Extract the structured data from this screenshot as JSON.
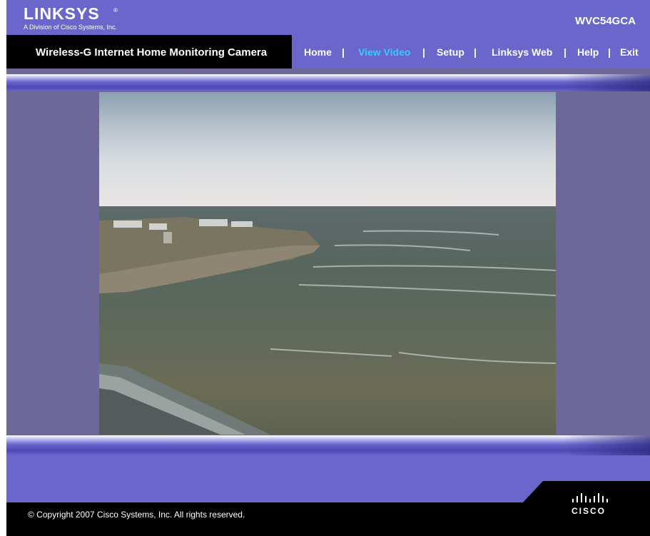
{
  "header": {
    "brand": "LINKSYS",
    "brand_mark": "®",
    "tagline": "A Division of Cisco Systems, Inc.",
    "model": "WVC54GCA"
  },
  "product": {
    "name": "Wireless-G Internet Home Monitoring Camera"
  },
  "nav": {
    "items": [
      {
        "label": "Home",
        "active": false
      },
      {
        "label": "View Video",
        "active": true
      },
      {
        "label": "Setup",
        "active": false
      },
      {
        "label": "Linksys Web",
        "active": false
      },
      {
        "label": "Help",
        "active": false
      },
      {
        "label": "Exit",
        "active": false
      }
    ],
    "separator": "|"
  },
  "footer": {
    "copyright": "© Copyright 2007 Cisco Systems, Inc. All rights reserved.",
    "logo_text": "CISCO"
  },
  "colors": {
    "header_bg": "#6a66cc",
    "bar_bg": "#000000",
    "active_nav": "#33ccff",
    "side_panel": "#6e689a"
  }
}
